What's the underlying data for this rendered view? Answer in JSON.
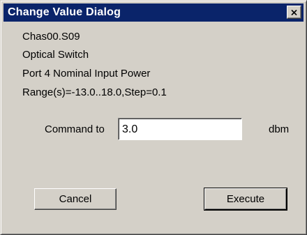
{
  "window": {
    "title": "Change Value Dialog",
    "close_icon": "close-icon",
    "titlebar_color": "#0a246a",
    "face_color": "#d4d0c8"
  },
  "info": {
    "chassis": "Chas00.S09",
    "device": "Optical Switch",
    "parameter": "Port 4 Nominal Input Power",
    "range": "Range(s)=-13.0..18.0,Step=0.1"
  },
  "command": {
    "label": "Command to",
    "value": "3.0",
    "unit": "dbm"
  },
  "buttons": {
    "cancel_label": "Cancel",
    "execute_label": "Execute"
  }
}
